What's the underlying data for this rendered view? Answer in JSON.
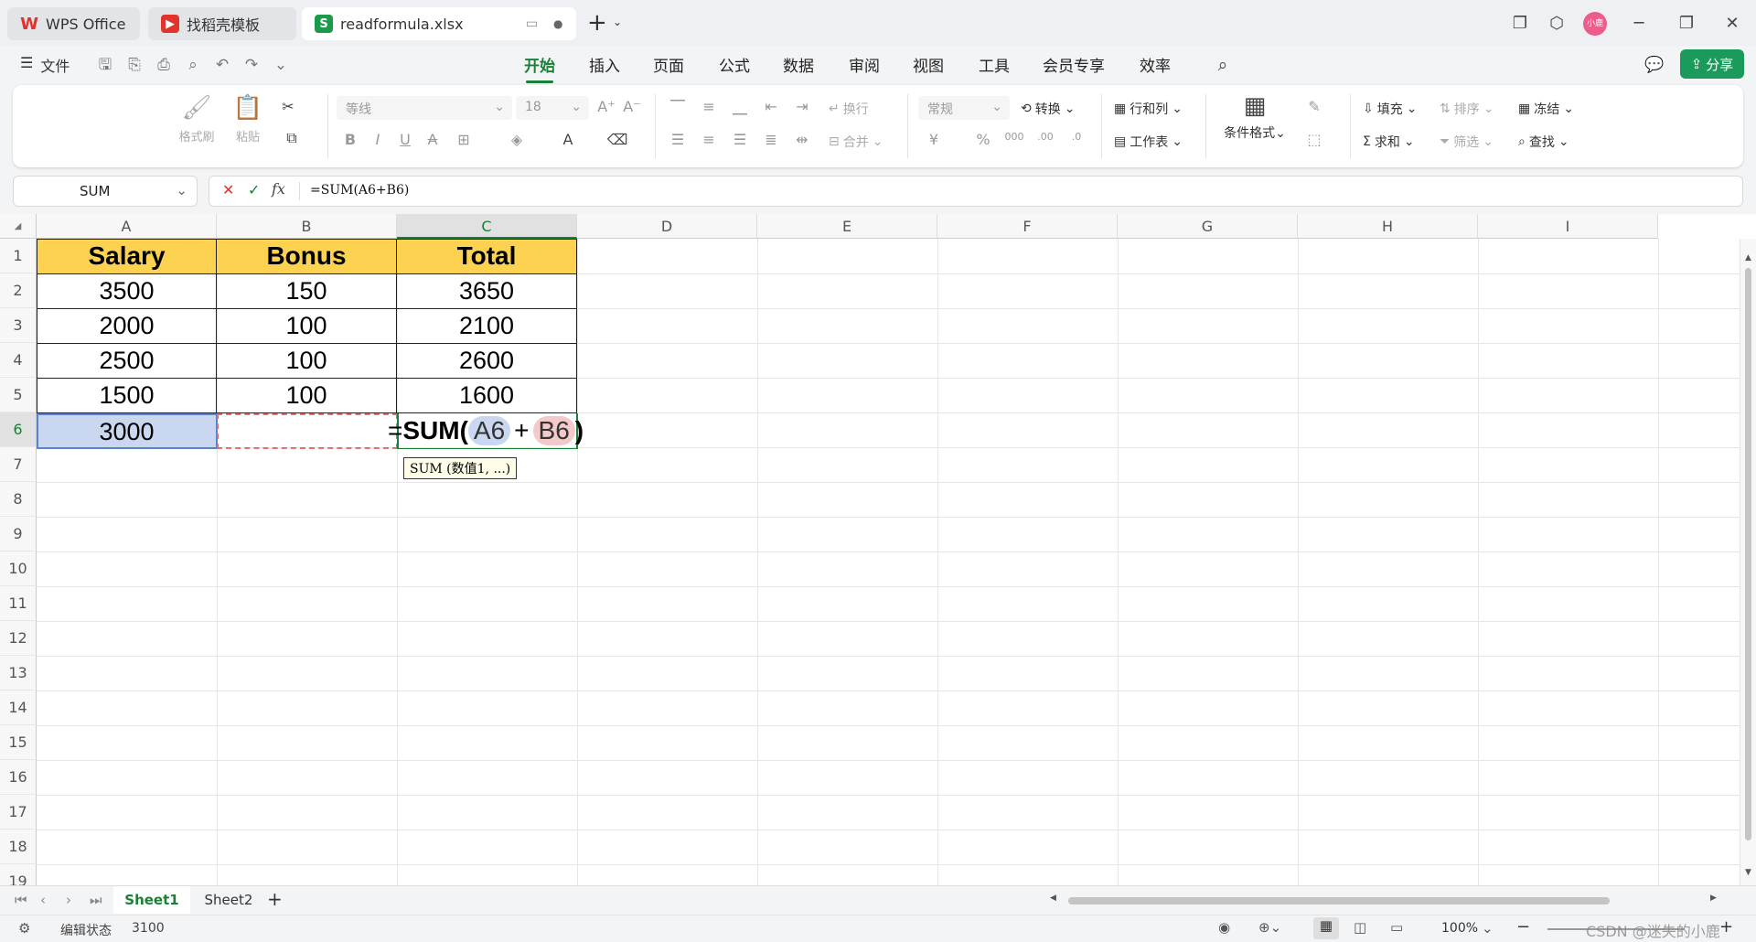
{
  "tabs": [
    {
      "label": "WPS Office"
    },
    {
      "label": "找稻壳模板"
    },
    {
      "label": "readformula.xlsx"
    }
  ],
  "user_badge": "小鹿",
  "menu": {
    "file_label": "文件",
    "items": [
      "开始",
      "插入",
      "页面",
      "公式",
      "数据",
      "审阅",
      "视图",
      "工具",
      "会员专享",
      "效率"
    ],
    "active": "开始",
    "share_label": "分享"
  },
  "ribbon": {
    "format_painter": "格式刷",
    "paste": "粘贴",
    "font_name": "等线",
    "font_size": "18",
    "wrap": "换行",
    "merge": "合并",
    "number_format": "常规",
    "convert": "转换",
    "row_col": "行和列",
    "worksheet": "工作表",
    "cond_format": "条件格式",
    "fill": "填充",
    "sort": "排序",
    "freeze": "冻结",
    "sum": "求和",
    "filter": "筛选",
    "find": "查找"
  },
  "formula_bar": {
    "name_box": "SUM",
    "formula": "=SUM(A6+B6)"
  },
  "columns": [
    "A",
    "B",
    "C",
    "D",
    "E",
    "F",
    "G",
    "H",
    "I"
  ],
  "rows": [
    "1",
    "2",
    "3",
    "4",
    "5",
    "6",
    "7",
    "8",
    "9",
    "10",
    "11",
    "12",
    "13",
    "14",
    "15",
    "16",
    "17",
    "18",
    "19"
  ],
  "table": {
    "headers": [
      "Salary",
      "Bonus",
      "Total"
    ],
    "data": [
      [
        "3500",
        "150",
        "3650"
      ],
      [
        "2000",
        "100",
        "2100"
      ],
      [
        "2500",
        "100",
        "2600"
      ],
      [
        "1500",
        "100",
        "1600"
      ]
    ],
    "row6_a": "3000"
  },
  "editing": {
    "eq": "=",
    "fn": "SUM(",
    "ref1": "A6",
    "plus": "+",
    "ref2": "B6",
    "close": ")",
    "tooltip": "SUM (数值1, ...)"
  },
  "sheets": [
    "Sheet1",
    "Sheet2"
  ],
  "active_sheet": "Sheet1",
  "status": {
    "mode": "编辑状态",
    "value": "3100",
    "zoom": "100%",
    "watermark": "CSDN @迷失的小鹿"
  },
  "colors": {
    "accent": "#1a7f37",
    "header_fill": "#fdd250",
    "ref1_fill": "#c9d7f0",
    "ref2_fill": "#f4c9c9"
  }
}
